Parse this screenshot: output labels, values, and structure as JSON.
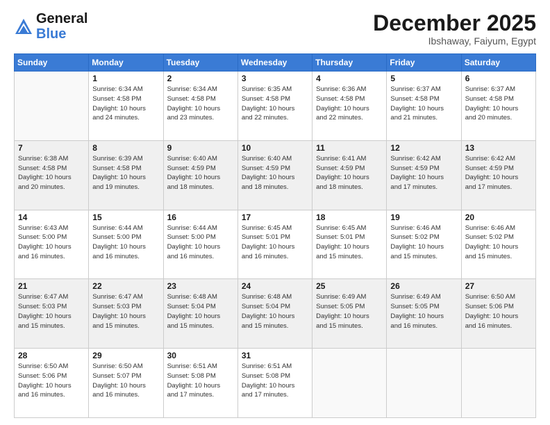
{
  "header": {
    "logo": {
      "general": "General",
      "blue": "Blue"
    },
    "month": "December 2025",
    "location": "Ibshaway, Faiyum, Egypt"
  },
  "weekdays": [
    "Sunday",
    "Monday",
    "Tuesday",
    "Wednesday",
    "Thursday",
    "Friday",
    "Saturday"
  ],
  "weeks": [
    [
      {
        "day": "",
        "info": ""
      },
      {
        "day": "1",
        "info": "Sunrise: 6:34 AM\nSunset: 4:58 PM\nDaylight: 10 hours\nand 24 minutes."
      },
      {
        "day": "2",
        "info": "Sunrise: 6:34 AM\nSunset: 4:58 PM\nDaylight: 10 hours\nand 23 minutes."
      },
      {
        "day": "3",
        "info": "Sunrise: 6:35 AM\nSunset: 4:58 PM\nDaylight: 10 hours\nand 22 minutes."
      },
      {
        "day": "4",
        "info": "Sunrise: 6:36 AM\nSunset: 4:58 PM\nDaylight: 10 hours\nand 22 minutes."
      },
      {
        "day": "5",
        "info": "Sunrise: 6:37 AM\nSunset: 4:58 PM\nDaylight: 10 hours\nand 21 minutes."
      },
      {
        "day": "6",
        "info": "Sunrise: 6:37 AM\nSunset: 4:58 PM\nDaylight: 10 hours\nand 20 minutes."
      }
    ],
    [
      {
        "day": "7",
        "info": "Sunrise: 6:38 AM\nSunset: 4:58 PM\nDaylight: 10 hours\nand 20 minutes."
      },
      {
        "day": "8",
        "info": "Sunrise: 6:39 AM\nSunset: 4:58 PM\nDaylight: 10 hours\nand 19 minutes."
      },
      {
        "day": "9",
        "info": "Sunrise: 6:40 AM\nSunset: 4:59 PM\nDaylight: 10 hours\nand 18 minutes."
      },
      {
        "day": "10",
        "info": "Sunrise: 6:40 AM\nSunset: 4:59 PM\nDaylight: 10 hours\nand 18 minutes."
      },
      {
        "day": "11",
        "info": "Sunrise: 6:41 AM\nSunset: 4:59 PM\nDaylight: 10 hours\nand 18 minutes."
      },
      {
        "day": "12",
        "info": "Sunrise: 6:42 AM\nSunset: 4:59 PM\nDaylight: 10 hours\nand 17 minutes."
      },
      {
        "day": "13",
        "info": "Sunrise: 6:42 AM\nSunset: 4:59 PM\nDaylight: 10 hours\nand 17 minutes."
      }
    ],
    [
      {
        "day": "14",
        "info": "Sunrise: 6:43 AM\nSunset: 5:00 PM\nDaylight: 10 hours\nand 16 minutes."
      },
      {
        "day": "15",
        "info": "Sunrise: 6:44 AM\nSunset: 5:00 PM\nDaylight: 10 hours\nand 16 minutes."
      },
      {
        "day": "16",
        "info": "Sunrise: 6:44 AM\nSunset: 5:00 PM\nDaylight: 10 hours\nand 16 minutes."
      },
      {
        "day": "17",
        "info": "Sunrise: 6:45 AM\nSunset: 5:01 PM\nDaylight: 10 hours\nand 16 minutes."
      },
      {
        "day": "18",
        "info": "Sunrise: 6:45 AM\nSunset: 5:01 PM\nDaylight: 10 hours\nand 15 minutes."
      },
      {
        "day": "19",
        "info": "Sunrise: 6:46 AM\nSunset: 5:02 PM\nDaylight: 10 hours\nand 15 minutes."
      },
      {
        "day": "20",
        "info": "Sunrise: 6:46 AM\nSunset: 5:02 PM\nDaylight: 10 hours\nand 15 minutes."
      }
    ],
    [
      {
        "day": "21",
        "info": "Sunrise: 6:47 AM\nSunset: 5:03 PM\nDaylight: 10 hours\nand 15 minutes."
      },
      {
        "day": "22",
        "info": "Sunrise: 6:47 AM\nSunset: 5:03 PM\nDaylight: 10 hours\nand 15 minutes."
      },
      {
        "day": "23",
        "info": "Sunrise: 6:48 AM\nSunset: 5:04 PM\nDaylight: 10 hours\nand 15 minutes."
      },
      {
        "day": "24",
        "info": "Sunrise: 6:48 AM\nSunset: 5:04 PM\nDaylight: 10 hours\nand 15 minutes."
      },
      {
        "day": "25",
        "info": "Sunrise: 6:49 AM\nSunset: 5:05 PM\nDaylight: 10 hours\nand 15 minutes."
      },
      {
        "day": "26",
        "info": "Sunrise: 6:49 AM\nSunset: 5:05 PM\nDaylight: 10 hours\nand 16 minutes."
      },
      {
        "day": "27",
        "info": "Sunrise: 6:50 AM\nSunset: 5:06 PM\nDaylight: 10 hours\nand 16 minutes."
      }
    ],
    [
      {
        "day": "28",
        "info": "Sunrise: 6:50 AM\nSunset: 5:06 PM\nDaylight: 10 hours\nand 16 minutes."
      },
      {
        "day": "29",
        "info": "Sunrise: 6:50 AM\nSunset: 5:07 PM\nDaylight: 10 hours\nand 16 minutes."
      },
      {
        "day": "30",
        "info": "Sunrise: 6:51 AM\nSunset: 5:08 PM\nDaylight: 10 hours\nand 17 minutes."
      },
      {
        "day": "31",
        "info": "Sunrise: 6:51 AM\nSunset: 5:08 PM\nDaylight: 10 hours\nand 17 minutes."
      },
      {
        "day": "",
        "info": ""
      },
      {
        "day": "",
        "info": ""
      },
      {
        "day": "",
        "info": ""
      }
    ]
  ]
}
